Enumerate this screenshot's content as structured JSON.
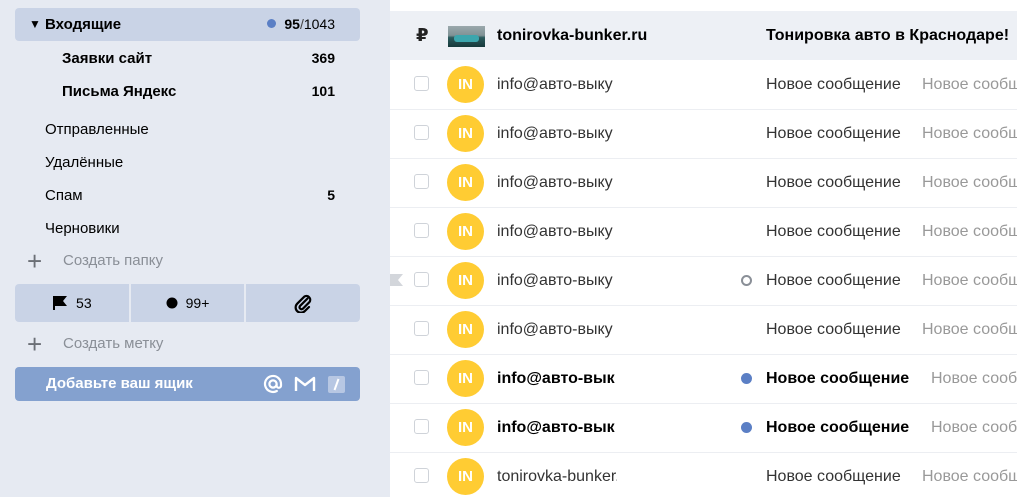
{
  "sidebar": {
    "inbox": {
      "arrow": "▼",
      "label": "Входящие",
      "unread": "95",
      "separator": "/",
      "total": "1043"
    },
    "subfolders": [
      {
        "label": "Заявки сайт",
        "count": "369"
      },
      {
        "label": "Письма Яндекс",
        "count": "101"
      }
    ],
    "folders": [
      {
        "label": "Отправленные",
        "count": ""
      },
      {
        "label": "Удалённые",
        "count": ""
      },
      {
        "label": "Спам",
        "count": "5"
      },
      {
        "label": "Черновики",
        "count": ""
      }
    ],
    "create_folder": "Создать папку",
    "labels": {
      "flagged": "53",
      "unread": "99+",
      "attachments_icon": "paperclip-icon"
    },
    "create_label": "Создать метку",
    "add_mailbox": "Добавьте ваш ящик",
    "mailbox_services": [
      "at-icon",
      "gmail-icon",
      "slash-icon"
    ]
  },
  "ad_row": {
    "currency_icon": "₽",
    "sender": "tonirovka-bunker.ru",
    "subject": "Тонировка авто в Краснодаре!"
  },
  "messages": [
    {
      "avatar": "IN",
      "from": "info@авто-выку",
      "subject": "Новое сообщение",
      "snippet": "Новое сообщение",
      "unread": false,
      "indicator": "none",
      "flag_mark": false
    },
    {
      "avatar": "IN",
      "from": "info@авто-выку",
      "subject": "Новое сообщение",
      "snippet": "Новое сообщение",
      "unread": false,
      "indicator": "none",
      "flag_mark": false
    },
    {
      "avatar": "IN",
      "from": "info@авто-выку",
      "subject": "Новое сообщение",
      "snippet": "Новое сообщение",
      "unread": false,
      "indicator": "none",
      "flag_mark": false
    },
    {
      "avatar": "IN",
      "from": "info@авто-выку",
      "subject": "Новое сообщение",
      "snippet": "Новое сообщение",
      "unread": false,
      "indicator": "none",
      "flag_mark": false
    },
    {
      "avatar": "IN",
      "from": "info@авто-выку",
      "subject": "Новое сообщение",
      "snippet": "Новое сообщение",
      "unread": false,
      "indicator": "read-ring",
      "flag_mark": true
    },
    {
      "avatar": "IN",
      "from": "info@авто-выку",
      "subject": "Новое сообщение",
      "snippet": "Новое сообщение",
      "unread": false,
      "indicator": "none",
      "flag_mark": false
    },
    {
      "avatar": "IN",
      "from": "info@авто-вык",
      "subject": "Новое сообщение",
      "snippet": "Новое сообщение",
      "unread": true,
      "indicator": "unread-dot",
      "flag_mark": false
    },
    {
      "avatar": "IN",
      "from": "info@авто-вык",
      "subject": "Новое сообщение",
      "snippet": "Новое сообщение",
      "unread": true,
      "indicator": "unread-dot",
      "flag_mark": false
    },
    {
      "avatar": "IN",
      "from": "tonirovka-bunker.ru",
      "subject": "Новое сообщение",
      "snippet": "Новое сообщение",
      "unread": false,
      "indicator": "none",
      "flag_mark": false
    }
  ],
  "colors": {
    "accent": "#5b7fc5",
    "avatar": "#ffcc33",
    "add_box": "#84a1cf",
    "sidebar_bg": "#e6eaf2",
    "selected_bg": "#c9d3e6"
  }
}
